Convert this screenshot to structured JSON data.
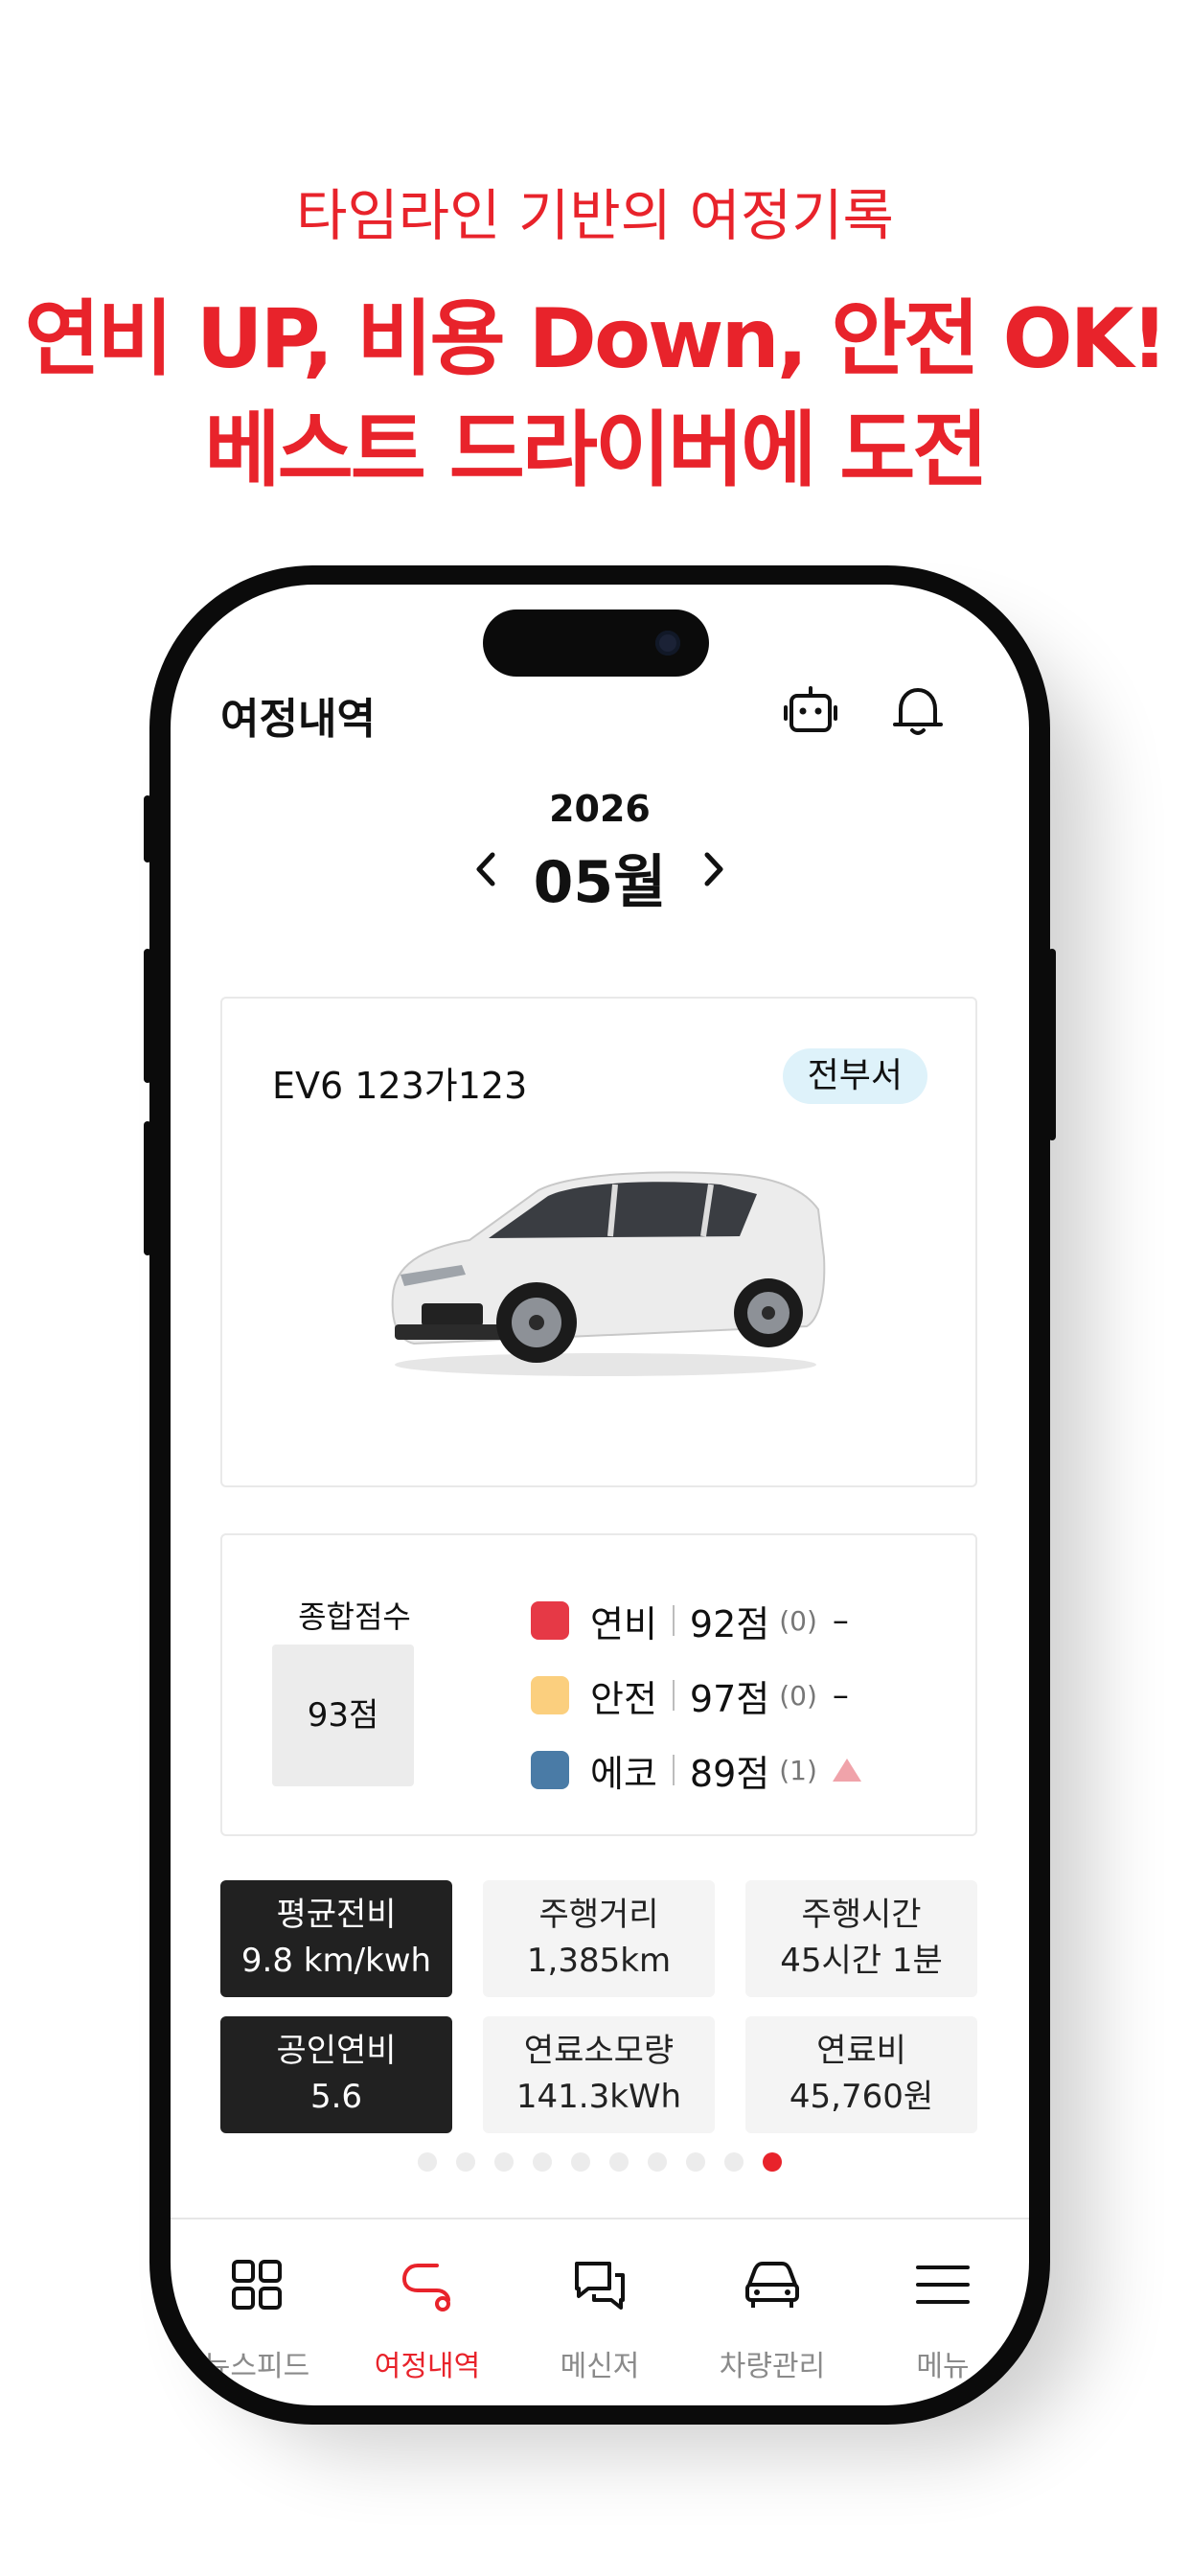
{
  "promo": {
    "subtitle": "타임라인 기반의 여정기록",
    "headline_line1": "연비 UP, 비용 Down, 안전 OK!",
    "headline_line2": "베스트 드라이버에 도전"
  },
  "header": {
    "title": "여정내역",
    "icons": [
      "robot-icon",
      "bell-icon"
    ]
  },
  "date_nav": {
    "year": "2026",
    "month": "05월"
  },
  "vehicle": {
    "name": "EV6 123가123",
    "department_badge": "전부서"
  },
  "scores": {
    "total_label": "종합점수",
    "total_value": "93점",
    "items": [
      {
        "label": "연비",
        "score": "92점",
        "count": "(0)",
        "trend": "–",
        "color": "#e63946"
      },
      {
        "label": "안전",
        "score": "97점",
        "count": "(0)",
        "trend": "–",
        "color": "#fbcf7e"
      },
      {
        "label": "에코",
        "score": "89점",
        "count": "(1)",
        "trend": "up",
        "color": "#4a7ba6"
      }
    ]
  },
  "stats": [
    {
      "label": "평균전비",
      "value": "9.8 km/kwh",
      "highlighted": true
    },
    {
      "label": "주행거리",
      "value": "1,385km",
      "highlighted": false
    },
    {
      "label": "주행시간",
      "value": "45시간 1분",
      "highlighted": false
    },
    {
      "label": "공인연비",
      "value": "5.6",
      "highlighted": true
    },
    {
      "label": "연료소모량",
      "value": "141.3kWh",
      "highlighted": false
    },
    {
      "label": "연료비",
      "value": "45,760원",
      "highlighted": false
    }
  ],
  "pagination": {
    "total": 10,
    "current": 10
  },
  "tabbar": {
    "items": [
      {
        "label": "뉴스피드",
        "icon": "grid-icon"
      },
      {
        "label": "여정내역",
        "icon": "route-icon",
        "active": true
      },
      {
        "label": "메신저",
        "icon": "chat-icon"
      },
      {
        "label": "차량관리",
        "icon": "car-icon"
      },
      {
        "label": "메뉴",
        "icon": "menu-icon"
      }
    ]
  },
  "colors": {
    "accent": "#e8232b",
    "dark_tile": "#212121"
  }
}
